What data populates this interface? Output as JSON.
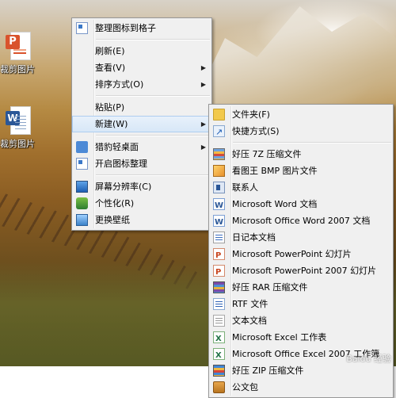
{
  "desktop": {
    "icons": [
      {
        "label": "裁剪图片",
        "type": "powerpoint"
      },
      {
        "label": "裁剪图片",
        "type": "word"
      }
    ]
  },
  "context_menu": {
    "items": [
      {
        "label": "整理图标到格子",
        "icon": "grid-icon"
      },
      {
        "label": "刷新(E)"
      },
      {
        "label": "查看(V)",
        "submenu": true
      },
      {
        "label": "排序方式(O)",
        "submenu": true
      },
      {
        "label": "粘贴(P)"
      },
      {
        "label": "新建(W)",
        "submenu": true,
        "active": true
      },
      {
        "label": "猎豹轻桌面",
        "icon": "cheetah-icon",
        "submenu": true
      },
      {
        "label": "开启图标整理",
        "icon": "grid-icon"
      },
      {
        "label": "屏幕分辨率(C)",
        "icon": "monitor-icon"
      },
      {
        "label": "个性化(R)",
        "icon": "personalize-icon"
      },
      {
        "label": "更换壁纸",
        "icon": "wallpaper-icon"
      }
    ]
  },
  "new_submenu": {
    "items": [
      {
        "label": "文件夹(F)",
        "icon": "folder-icon"
      },
      {
        "label": "快捷方式(S)",
        "icon": "shortcut-icon"
      },
      {
        "label": "好压 7Z 压缩文件",
        "icon": "7z-archive-icon"
      },
      {
        "label": "看图王 BMP 图片文件",
        "icon": "bmp-image-icon"
      },
      {
        "label": "联系人",
        "icon": "contact-icon"
      },
      {
        "label": "Microsoft Word 文档",
        "icon": "word-doc-icon"
      },
      {
        "label": "Microsoft Office Word 2007 文档",
        "icon": "word-doc-icon"
      },
      {
        "label": "日记本文档",
        "icon": "journal-icon"
      },
      {
        "label": "Microsoft PowerPoint 幻灯片",
        "icon": "powerpoint-icon"
      },
      {
        "label": "Microsoft PowerPoint 2007 幻灯片",
        "icon": "powerpoint-icon"
      },
      {
        "label": "好压 RAR 压缩文件",
        "icon": "rar-archive-icon"
      },
      {
        "label": "RTF 文件",
        "icon": "rtf-icon"
      },
      {
        "label": "文本文档",
        "icon": "text-doc-icon"
      },
      {
        "label": "Microsoft Excel 工作表",
        "icon": "excel-icon"
      },
      {
        "label": "Microsoft Office Excel 2007 工作簿",
        "icon": "excel-icon"
      },
      {
        "label": "好压 ZIP 压缩文件",
        "icon": "zip-archive-icon"
      },
      {
        "label": "公文包",
        "icon": "briefcase-icon"
      }
    ]
  },
  "watermark": "Baidu 经验"
}
